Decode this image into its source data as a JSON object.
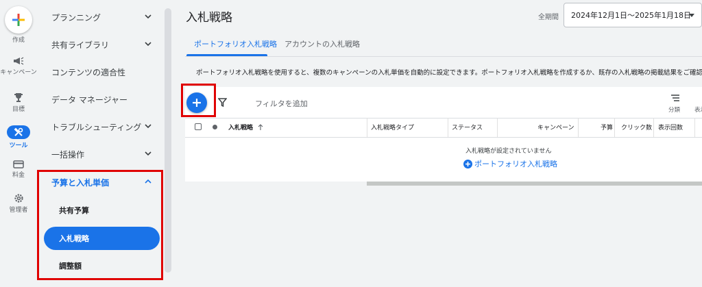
{
  "rail": {
    "create_label": "作成",
    "items": [
      {
        "label": "キャンペーン",
        "icon": "megaphone-icon"
      },
      {
        "label": "目標",
        "icon": "trophy-icon"
      },
      {
        "label": "ツール",
        "icon": "tools-icon",
        "active": true
      },
      {
        "label": "料金",
        "icon": "credit-card-icon"
      },
      {
        "label": "管理者",
        "icon": "gear-icon"
      }
    ]
  },
  "nav": {
    "items": [
      {
        "label": "プランニング",
        "expandable": true
      },
      {
        "label": "共有ライブラリ",
        "expandable": true
      },
      {
        "label": "コンテンツの適合性",
        "expandable": false
      },
      {
        "label": "データ マネージャー",
        "expandable": false
      },
      {
        "label": "トラブルシューティング",
        "expandable": true
      },
      {
        "label": "一括操作",
        "expandable": true
      }
    ],
    "budget_section": {
      "label": "予算と入札単価",
      "children": [
        "共有予算",
        "入札戦略",
        "調整額"
      ],
      "active_child": "入札戦略"
    }
  },
  "header": {
    "title": "入札戦略",
    "period_label": "全期間",
    "date_range": "2024年12月1日～2025年1月18日"
  },
  "tabs": [
    {
      "label": "ポートフォリオ入札戦略",
      "active": true
    },
    {
      "label": "アカウントの入札戦略",
      "active": false
    }
  ],
  "description": "ポートフォリオ入札戦略を使用すると、複数のキャンペーンの入札単価を自動的に設定できます。ポートフォリオ入札戦略を作成するか、既存の入札戦略の掲載結果をご確認ください。",
  "toolbar": {
    "filter_placeholder": "フィルタを追加",
    "segment_label": "分類",
    "display_label": "表示"
  },
  "table": {
    "columns": [
      "入札戦略",
      "入札戦略タイプ",
      "ステータス",
      "キャンペーン",
      "予算",
      "クリック数",
      "表示回数"
    ],
    "empty_message": "入札戦略が設定されていません",
    "empty_action": "ポートフォリオ入札戦略"
  },
  "colors": {
    "accent": "#1a73e8",
    "highlight": "#e00000"
  }
}
